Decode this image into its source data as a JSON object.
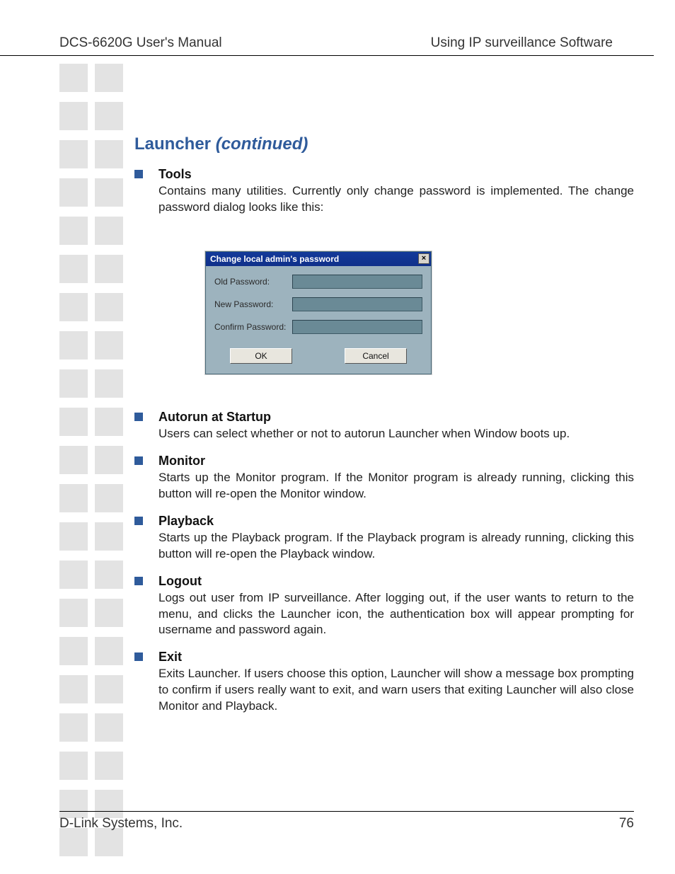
{
  "header": {
    "left": "DCS-6620G User's Manual",
    "right": "Using IP surveillance Software"
  },
  "title": {
    "main": "Launcher ",
    "cont": "(continued)"
  },
  "items": [
    {
      "heading": "Tools",
      "body": "Contains many utilities. Currently only change password is implemented. The change password dialog looks like this:"
    },
    {
      "heading": "Autorun at Startup",
      "body": "Users can select whether or not to autorun Launcher when Window boots up."
    },
    {
      "heading": "Monitor",
      "body": "Starts up the Monitor program. If the Monitor program is already running, clicking this button will re-open the Monitor window."
    },
    {
      "heading": "Playback",
      "body": "Starts up the Playback program. If the Playback program is already running, clicking this button will re-open the Playback window."
    },
    {
      "heading": "Logout",
      "body": "Logs out user from IP surveillance. After logging out, if the user wants to return to the menu, and clicks the Launcher icon, the authentication box will appear prompting for username and password again."
    },
    {
      "heading": "Exit",
      "body": "Exits Launcher. If users choose this option, Launcher will show a message box prompting to confirm if users really want to exit, and warn users that exiting Launcher will also close Monitor and Playback."
    }
  ],
  "dialog": {
    "title": "Change local admin's password",
    "fields": {
      "old": "Old Password:",
      "new": "New Password:",
      "confirm": "Confirm Password:"
    },
    "buttons": {
      "ok": "OK",
      "cancel": "Cancel"
    },
    "close_glyph": "×"
  },
  "footer": {
    "left": "D-Link Systems, Inc.",
    "page": "76"
  }
}
